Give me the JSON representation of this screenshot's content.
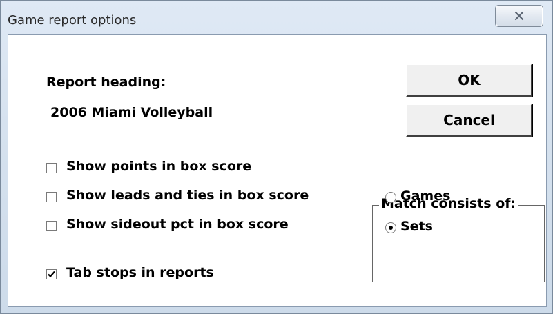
{
  "window": {
    "title": "Game report options",
    "close_icon": "close-x-icon"
  },
  "report_heading": {
    "label": "Report heading:",
    "value": "2006 Miami Volleyball"
  },
  "buttons": {
    "ok": "OK",
    "cancel": "Cancel"
  },
  "options": [
    {
      "label": "Show points in box score",
      "checked": false
    },
    {
      "label": "Show leads and ties in box score",
      "checked": false
    },
    {
      "label": "Show sideout pct in box score",
      "checked": false
    },
    {
      "label": "Tab stops in reports",
      "checked": true
    }
  ],
  "match_group": {
    "legend": "Match consists of:",
    "choices": [
      {
        "label": "Games",
        "selected": false
      },
      {
        "label": "Sets",
        "selected": true
      }
    ]
  }
}
